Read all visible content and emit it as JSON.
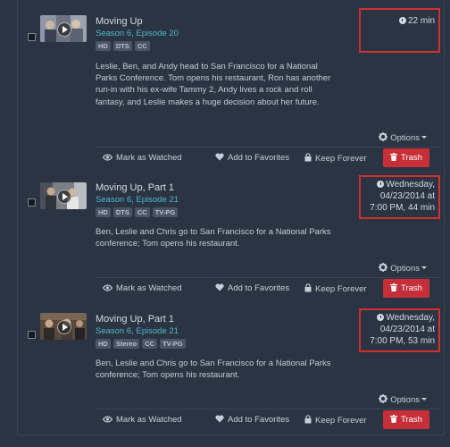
{
  "episodes": [
    {
      "title": "Moving Up",
      "episode": "Season 6, Episode 20",
      "badges": [
        "HD",
        "DTS",
        "CC"
      ],
      "description": "Leslie, Ben, and Andy head to San Francisco for a National Parks Conference. Tom opens his restaurant, Ron has another run-in with his ex-wife Tammy 2, Andy lives a rock and roll fantasy, and Leslie makes a huge decision about her future.",
      "airtime_lines": [
        "22 min"
      ],
      "thumb_icon": "play-icon"
    },
    {
      "title": "Moving Up, Part 1",
      "episode": "Season 6, Episode 21",
      "badges": [
        "HD",
        "DTS",
        "CC",
        "TV-PG"
      ],
      "description": "Ben, Leslie and Chris go to San Francisco for a National Parks conference; Tom opens his restaurant.",
      "airtime_lines": [
        "Wednesday,",
        "04/23/2014 at",
        "7:00 PM, 44 min"
      ],
      "thumb_icon": "play-icon"
    },
    {
      "title": "Moving Up, Part 1",
      "episode": "Season 6, Episode 21",
      "badges": [
        "HD",
        "Stereo",
        "CC",
        "TV-PG"
      ],
      "description": "Ben, Leslie and Chris go to San Francisco for a National Parks conference; Tom opens his restaurant.",
      "airtime_lines": [
        "Wednesday,",
        "04/23/2014 at",
        "7:00 PM, 53 min"
      ],
      "thumb_icon": "play-icon"
    }
  ],
  "labels": {
    "options": "Options",
    "mark_watched": "Mark as Watched",
    "add_favorites": "Add to Favorites",
    "keep_forever": "Keep Forever",
    "trash": "Trash"
  },
  "icons": {
    "clock": "clock-icon",
    "options": "gear-icon",
    "mark_watched": "eye-icon",
    "add_favorites": "heart-icon",
    "keep_forever": "lock-icon",
    "trash": "trash-icon"
  },
  "colors": {
    "background": "#2b3443",
    "accent_teal": "#4fb8c4",
    "trash_button": "#c62f38",
    "highlight_box": "#d32f2f"
  }
}
